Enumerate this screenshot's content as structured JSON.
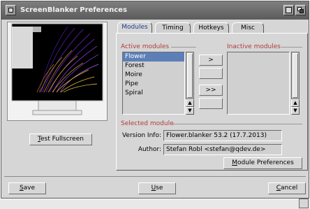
{
  "window": {
    "title": "ScreenBlanker Preferences"
  },
  "tabs": [
    {
      "label": "Modules",
      "active": true
    },
    {
      "label": "Timing",
      "active": false
    },
    {
      "label": "Hotkeys",
      "active": false
    },
    {
      "label": "Misc",
      "active": false
    }
  ],
  "modules": {
    "active_label": "Active modules",
    "inactive_label": "Inactive modules",
    "active": [
      "Flower",
      "Forest",
      "Moire",
      "Pipe",
      "Spiral"
    ],
    "selected_index": 0,
    "inactive": [],
    "move_one": ">",
    "move_all": ">>"
  },
  "selected_module": {
    "section_label": "Selected module",
    "version_label": "Version Info:",
    "version_value": "Flower.blanker 53.2 (17.7.2013)",
    "author_label": "Author:",
    "author_value": "Stefan Robl <stefan@qdev.de>",
    "prefs_button": "Module Preferences",
    "prefs_button_key": "M"
  },
  "preview": {
    "test_button": "Test Fullscreen",
    "test_button_key": "T"
  },
  "footer": {
    "save": "Save",
    "save_key": "S",
    "use": "Use",
    "use_key": "U",
    "cancel": "Cancel",
    "cancel_key": "C"
  },
  "colors": {
    "accent_selection": "#5c7fb8",
    "section_label": "#b33a3a",
    "tab_active_text": "#1f3f8f"
  }
}
